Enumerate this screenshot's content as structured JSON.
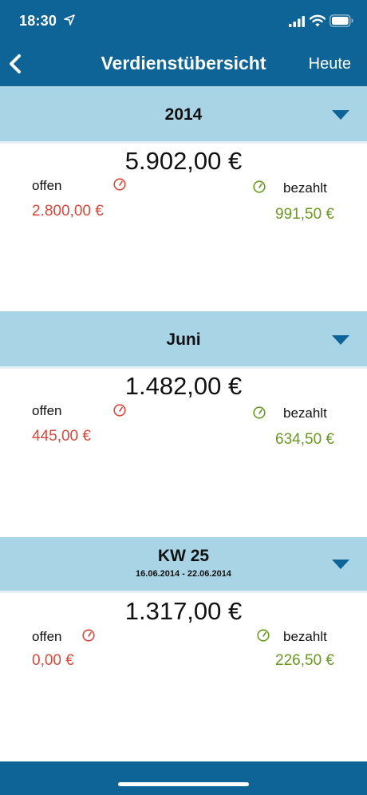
{
  "status_bar": {
    "time": "18:30"
  },
  "nav": {
    "title": "Verdienstübersicht",
    "right_label": "Heute"
  },
  "sections": [
    {
      "title": "2014",
      "subtitle": "",
      "total": "5.902,00 €",
      "open_label": "offen",
      "open_amount": "2.800,00 €",
      "paid_label": "bezahlt",
      "paid_amount": "991,50 €"
    },
    {
      "title": "Juni",
      "subtitle": "",
      "total": "1.482,00 €",
      "open_label": "offen",
      "open_amount": "445,00 €",
      "paid_label": "bezahlt",
      "paid_amount": "634,50 €"
    },
    {
      "title": "KW 25",
      "subtitle": "16.06.2014 - 22.06.2014",
      "total": "1.317,00 €",
      "open_label": "offen",
      "open_amount": "0,00 €",
      "paid_label": "bezahlt",
      "paid_amount": "226,50 €"
    }
  ],
  "colors": {
    "bar": "#0e6496",
    "section_header": "#a9d4e5",
    "open": "#e0463a",
    "paid": "#6a9a1f"
  },
  "icons": [
    "location-arrow-icon",
    "signal-icon",
    "wifi-icon",
    "battery-icon",
    "back-chevron-icon",
    "chevron-down-icon",
    "open-gauge-icon",
    "paid-gauge-icon"
  ]
}
